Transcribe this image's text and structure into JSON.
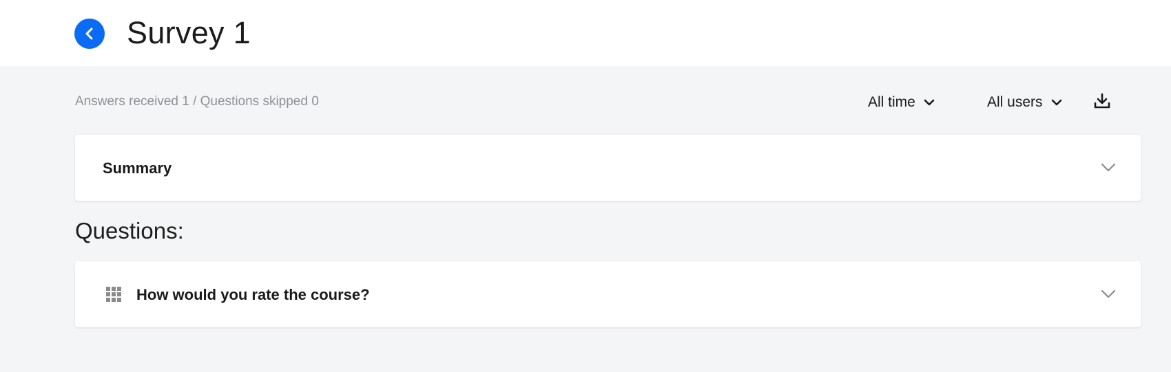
{
  "header": {
    "title": "Survey 1",
    "back_icon": "chevron-left-icon"
  },
  "toolbar": {
    "stats_text": "Answers received 1 / Questions skipped 0",
    "time_filter": "All time",
    "user_filter": "All users",
    "download_icon": "download-icon"
  },
  "summary": {
    "label": "Summary"
  },
  "questions": {
    "heading": "Questions:",
    "items": [
      {
        "label": "How would you rate the course?",
        "icon": "grid-icon"
      }
    ]
  },
  "colors": {
    "accent": "#0a6cf5",
    "background": "#f4f5f6",
    "muted_text": "#8e9196",
    "chevron": "#8a8a8a"
  }
}
